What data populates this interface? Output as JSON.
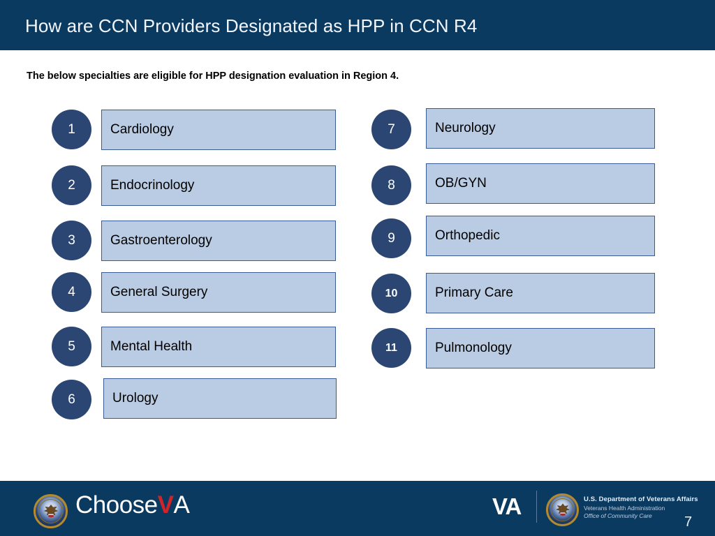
{
  "header": {
    "title": "How are CCN Providers Designated as HPP in CCN R4",
    "band_color": "#0b3a61"
  },
  "body": {
    "subtitle": "The below specialties are eligible for HPP designation evaluation in Region 4.",
    "box_fill": "#b9cce3",
    "box_border": "#3a5a92",
    "badge_color": "#2b4672",
    "columns": [
      {
        "name": "left-column",
        "items": [
          {
            "number": "1",
            "label": "Cardiology"
          },
          {
            "number": "2",
            "label": "Endocrinology"
          },
          {
            "number": "3",
            "label": "Gastroenterology"
          },
          {
            "number": "4",
            "label": "General Surgery"
          },
          {
            "number": "5",
            "label": "Mental Health"
          },
          {
            "number": "6",
            "label": "Urology"
          }
        ]
      },
      {
        "name": "right-column",
        "items": [
          {
            "number": "7",
            "label": "Neurology"
          },
          {
            "number": "8",
            "label": "OB/GYN"
          },
          {
            "number": "9",
            "label": "Orthopedic"
          },
          {
            "number": "10",
            "label": "Primary Care"
          },
          {
            "number": "11",
            "label": "Pulmonology"
          }
        ]
      }
    ]
  },
  "footer": {
    "band_color": "#0b3a61",
    "choose_va": {
      "choose": "Choose",
      "v": "V",
      "a": "A"
    },
    "va_mark": "VA",
    "agency": {
      "line1": "U.S. Department of Veterans Affairs",
      "line2": "Veterans Health Administration",
      "line3": "Office of Community Care"
    },
    "page_number": "7",
    "accent_red": "#d1232a"
  }
}
